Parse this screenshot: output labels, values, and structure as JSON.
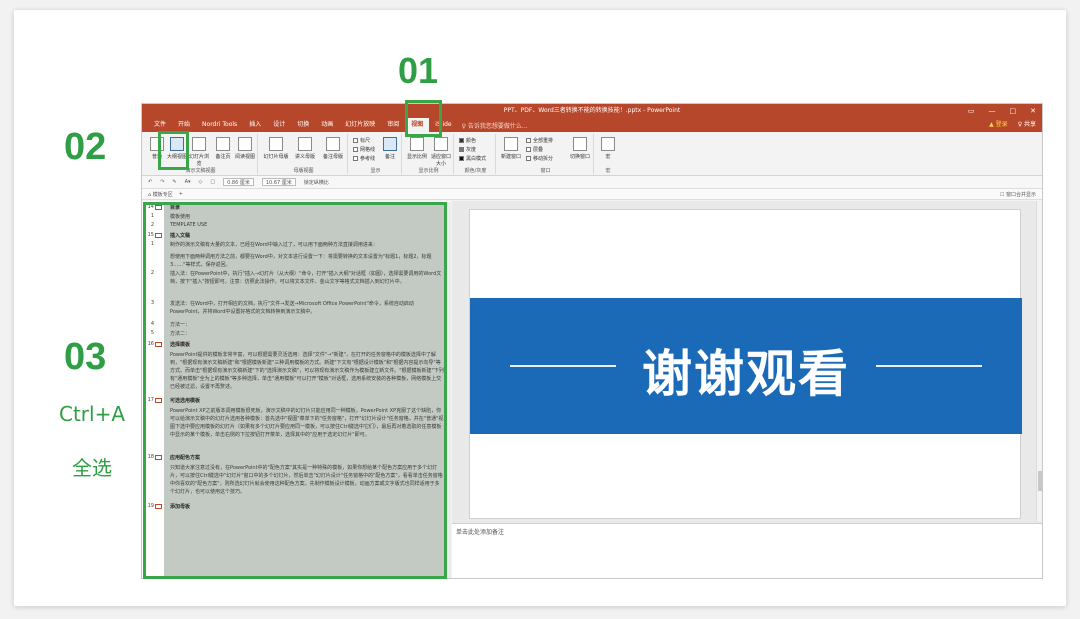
{
  "steps": {
    "s01": "01",
    "s02": "02",
    "s03": "03",
    "ctrl_a": "Ctrl+A",
    "select_all": "全选"
  },
  "window": {
    "title": "PPT、PDF、Word三者转换不能的转换技能！.pptx - PowerPoint",
    "controls": [
      "▭",
      "—",
      "□",
      "✕"
    ],
    "warning": "▲ 登录",
    "share": "♀ 共享"
  },
  "tabs": [
    "文件",
    "开始",
    "Nordri Tools",
    "插入",
    "设计",
    "切换",
    "动画",
    "幻灯片放映",
    "审阅",
    "视图",
    "iSlide"
  ],
  "active_tab": "视图",
  "tell_me": "♀ 告诉我您想要做什么...",
  "ribbon": {
    "groups": {
      "presentation_views": "演示文稿视图",
      "master_views": "母版视图",
      "show": "显示",
      "zoom": "显示比例",
      "color": "颜色/灰度",
      "window": "窗口",
      "macros": "宏"
    },
    "buttons": {
      "normal": "普通",
      "outline": "大纲视图",
      "slide_sorter": "幻灯片浏览",
      "notes_page": "备注页",
      "reading": "阅读视图",
      "slide_master": "幻灯片母版",
      "handout_master": "讲义母版",
      "notes_master": "备注母版",
      "notes": "备注",
      "zoom": "显示比例",
      "fit": "适应窗口大小",
      "new_window": "新建窗口",
      "switch_window": "切换窗口",
      "macro": "宏"
    },
    "checks": {
      "ruler": "标尺",
      "gridlines": "网格线",
      "guides": "参考线",
      "color": "颜色",
      "grayscale": "灰度",
      "bw": "黑白模式",
      "arrange_all": "全部重排",
      "cascade": "层叠",
      "move_split": "移动拆分"
    }
  },
  "toolbar": {
    "w": "0.86 厘米",
    "h": "10.67 厘米",
    "lock": "锁定纵横比"
  },
  "doc_tabs": {
    "tab": "⌂ 模板专区",
    "plus": "+",
    "right": "☐ 窗口合并显示"
  },
  "outline": {
    "rows": [
      {
        "num": "14",
        "slide": true,
        "text": "目录",
        "bold": true
      },
      {
        "num": "1",
        "slide": false,
        "text": "模板使用",
        "bold": false
      },
      {
        "num": "2",
        "slide": false,
        "text": "TEMPLATE USE",
        "bold": false
      },
      {
        "num": "15",
        "slide": true,
        "text": "插入文稿",
        "bold": true
      },
      {
        "num": "1",
        "slide": false,
        "text": "制作的演示文稿有大量的文本，已经在Word中输入过了，可以用下面两种方法直接调用进来：",
        "bold": false
      },
      {
        "num": "",
        "slide": false,
        "text": "想使用下面两种调用方法之前，都要在Word中，对文本进行设置一下：将需要转换的文本设置为\"标题1，标题2，标题3……\"等样式，保存返回。",
        "bold": false
      },
      {
        "num": "2",
        "slide": false,
        "text": "插入法：在PowerPoint中，执行\"插入→幻灯片（从大纲）\"命令，打开\"插入大纲\"对话框（如图），选择需要调用的Word文档，按下\"插入\"按钮即可。注意：仿照此法操作，可以将文本文件、金山文字等格式文档插入到幻灯片中。",
        "bold": false
      },
      {
        "num": "3",
        "slide": false,
        "text": "发送法：在Word中，打开相应的文档，执行\"文件→发送→Microsoft Office PowerPoint\"命令，系统自动启动PowerPoint，并将Word中设置好格式的文档转换到演示文稿中。",
        "bold": false
      },
      {
        "num": "4",
        "slide": false,
        "text": "方法一：",
        "bold": false
      },
      {
        "num": "5",
        "slide": false,
        "text": "方法二：",
        "bold": false
      },
      {
        "num": "16",
        "slide": true,
        "text": "选择模板",
        "bold": true
      },
      {
        "num": "",
        "slide": false,
        "text": "PowerPoint提供的模板非常丰富，可以根据需要灵活选用：选择\"文件\"→\"新建\"，在打开的任务窗格中的模板选择中了解到，\"根据现有演示文稿新建\"和\"根据模板新建\"三种调用模板的方式。新建\"下文有\"根据设计模板\"和\"根据内容提示向导\"等方式。而单击\"根据现有演示文稿新建\"下的\"选择演示文稿\"，可以将现有演示文稿作为模板建立新文件。\"根据模板新建\"下列有\"通用模板\"全为上的模板\"等多种选择，单击\"通用模板\"可以打开\"模板\"对话框，选用系统安装的各种模板，网络模板上交已经被过滤，设置不再赘述。",
        "bold": false
      },
      {
        "num": "17",
        "slide": true,
        "text": "可选选用模板",
        "bold": true
      },
      {
        "num": "",
        "slide": false,
        "text": "PowerPoint XP之前版本调用模板很死板，演示文稿中的幻灯片只能应用同一种模板。PowerPoint XP克服了这个缺陷，你可以给演示文稿中的幻灯片选用各种模板：首先选中\"视图\"菜单下的\"任务窗格\"，打开\"幻灯片设计\"任务窗格，并在\"普通\"视图下选中要应用模板的幻灯片（如果有多个幻灯片要应用同一模板，可以按住Ctrl键选中它们），最后再对着选取的任意模板中显示的某个模板，单击右侧的下拉按钮打开菜单，选择其中的\"应用于选定幻灯片\"即可。",
        "bold": false
      },
      {
        "num": "18",
        "slide": true,
        "text": "应用配色方案",
        "bold": true
      },
      {
        "num": "",
        "slide": false,
        "text": "只知道大家注意过没有，在PowerPoint中的\"配色方案\"其实是一种特殊的模板，如果你想给某个配色方案应用于多个幻灯片，可以按住Ctrl键选中\"幻灯片\"窗口中的多个幻灯片，然后单击\"幻灯片设计\"任务窗格中的\"配色方案\"，看看单击任务窗格中你喜欢的\"配色方案\"，则所选幻灯片就会使用这种配色方案。先制作模板设计模板，动画方案或文字版式也同样适用于多个幻灯片，也可以使用这个技巧。",
        "bold": false
      },
      {
        "num": "19",
        "slide": true,
        "text": "添加母板",
        "bold": true
      }
    ]
  },
  "slide": {
    "thanks": "谢谢观看",
    "notes_placeholder": "单击此处添加备注"
  },
  "colors": {
    "accent_green": "#3aa64a",
    "ppt_red": "#b7472a",
    "slide_blue": "#1b6ab8"
  }
}
